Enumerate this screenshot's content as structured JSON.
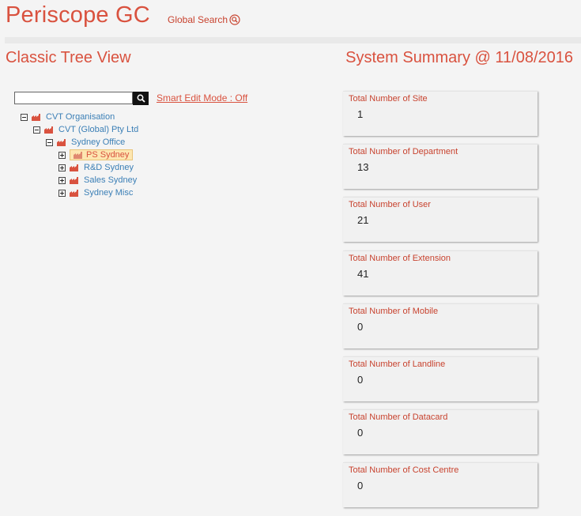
{
  "header": {
    "app_title": "Periscope GC",
    "global_search_label": "Global Search"
  },
  "tree_panel": {
    "title": "Classic Tree View",
    "search_placeholder": "",
    "search_value": "",
    "smart_edit_label": "Smart Edit Mode : Off",
    "nodes": [
      {
        "label": "CVT Organisation",
        "state": "expanded"
      },
      {
        "label": "CVT (Global) Pty Ltd",
        "state": "expanded"
      },
      {
        "label": "Sydney Office",
        "state": "expanded"
      },
      {
        "label": "PS Sydney",
        "state": "collapsed",
        "selected": true
      },
      {
        "label": "R&D Sydney",
        "state": "collapsed"
      },
      {
        "label": "Sales Sydney",
        "state": "collapsed"
      },
      {
        "label": "Sydney Misc",
        "state": "collapsed"
      }
    ]
  },
  "summary_panel": {
    "title": "System Summary @ 11/08/2016",
    "cards": [
      {
        "label": "Total Number of Site",
        "value": "1"
      },
      {
        "label": "Total Number of Department",
        "value": "13"
      },
      {
        "label": "Total Number of User",
        "value": "21"
      },
      {
        "label": "Total Number of Extension",
        "value": "41"
      },
      {
        "label": "Total Number of Mobile",
        "value": "0"
      },
      {
        "label": "Total Number of Landline",
        "value": "0"
      },
      {
        "label": "Total Number of Datacard",
        "value": "0"
      },
      {
        "label": "Total Number of Cost Centre",
        "value": "0"
      }
    ]
  },
  "colors": {
    "accent": "#d9523f",
    "tree_link": "#3b7fb6",
    "background": "#f4f4f4",
    "selected_bg": "#fde6b0"
  },
  "icons": {
    "search": "magnifier-icon",
    "tree_node": "factory-icon",
    "expand": "plus-box-icon",
    "collapse": "minus-box-icon"
  }
}
